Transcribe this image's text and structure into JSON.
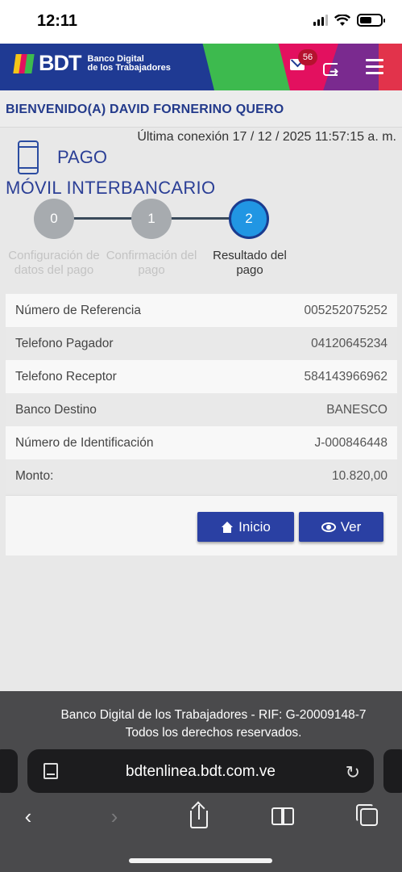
{
  "status_bar": {
    "time": "12:11"
  },
  "header": {
    "brand": "BDT",
    "brand_sub_1": "Banco Digital",
    "brand_sub_2": "de los Trabajadores",
    "mail_badge": "56",
    "colors": {
      "navy": "#1f3a93",
      "green": "#3dba4e",
      "pink": "#e3105f",
      "purple": "#7a2a8f"
    }
  },
  "welcome": "BIENVENIDO(A) DAVID FORNERINO QUERO",
  "last_connection": "Última conexión 17 / 12 / 2025 11:57:15 a. m.",
  "page": {
    "title_line1": "PAGO",
    "title_line2": "MÓVIL INTERBANCARIO"
  },
  "steps": [
    {
      "number": "0",
      "label": "Configuración de datos del pago",
      "state": "done"
    },
    {
      "number": "1",
      "label": "Confirmación del pago",
      "state": "done"
    },
    {
      "number": "2",
      "label": "Resultado del pago",
      "state": "active"
    }
  ],
  "details": [
    {
      "label": "Número de Referencia",
      "value": "005252075252"
    },
    {
      "label": "Telefono Pagador",
      "value": "04120645234"
    },
    {
      "label": "Telefono Receptor",
      "value": "584143966962"
    },
    {
      "label": "Banco Destino",
      "value": "BANESCO"
    },
    {
      "label": "Número de Identificación",
      "value": "J-000846448"
    },
    {
      "label": "Monto:",
      "value": "10.820,00"
    }
  ],
  "actions": {
    "home_label": "Inicio",
    "view_label": "Ver"
  },
  "footer": {
    "line1": "Banco Digital de los Trabajadores - RIF: G-20009148-7",
    "line2": "Todos los derechos reservados."
  },
  "browser": {
    "url": "bdtenlinea.bdt.com.ve"
  }
}
